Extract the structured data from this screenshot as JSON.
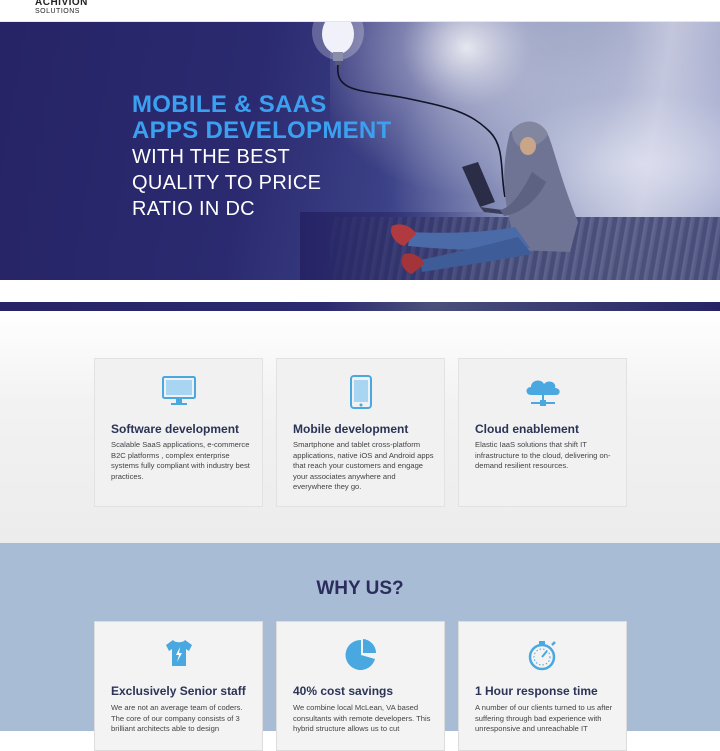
{
  "header": {
    "logo_line1": "ACHIVION",
    "logo_line2": "SOLUTIONS"
  },
  "hero": {
    "headline_1": "MOBILE & SAAS",
    "headline_2": "APPS DEVELOPMENT",
    "subline_1": "WITH THE BEST",
    "subline_2": "QUALITY TO PRICE",
    "subline_3": "RATIO IN DC"
  },
  "services": [
    {
      "icon": "monitor-icon",
      "title": "Software development",
      "description": "Scalable SaaS applications, e-commerce B2C platforms , complex enterprise systems fully compliant with industry best practices."
    },
    {
      "icon": "smartphone-icon",
      "title": "Mobile development",
      "description": "Smartphone and tablet cross-platform applications, native iOS and Android apps that reach your customers and engage your associates anywhere and everywhere they go."
    },
    {
      "icon": "cloud-icon",
      "title": "Cloud enablement",
      "description": "Elastic IaaS solutions that shift IT infrastructure to the cloud, delivering on-demand resilient resources."
    }
  ],
  "why": {
    "title": "WHY US?",
    "items": [
      {
        "icon": "tshirt-icon",
        "title": "Exclusively Senior staff",
        "description": "We are not an average team of coders. The core of our company consists of 3 brilliant architects able to design"
      },
      {
        "icon": "pie-chart-icon",
        "title": "40% cost savings",
        "description": "We combine local McLean, VA based consultants with remote developers. This hybrid structure allows us to cut"
      },
      {
        "icon": "stopwatch-icon",
        "title": "1 Hour response time",
        "description": "A number of our clients turned to us after suffering through bad experience with unresponsive and unreachable IT"
      }
    ]
  },
  "colors": {
    "hero_bg": "#262466",
    "headline": "#3ca0f0",
    "icon_blue": "#4aa8e0",
    "why_bg": "#a9bcd5",
    "title_dark": "#2c3456"
  }
}
